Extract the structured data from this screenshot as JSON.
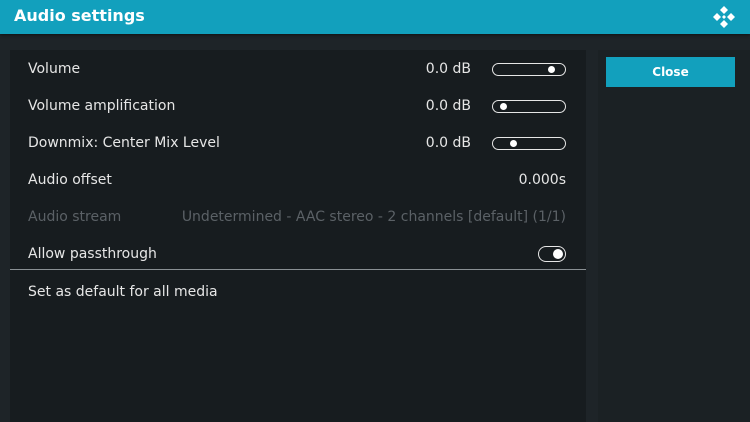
{
  "window": {
    "title": "Audio settings",
    "logo_icon": "kodi-logo-icon"
  },
  "settings": [
    {
      "label": "Volume",
      "value": "0.0 dB",
      "control": "slider",
      "position": 0.92
    },
    {
      "label": "Volume amplification",
      "value": "0.0 dB",
      "control": "slider",
      "position": 0.08
    },
    {
      "label": "Downmix: Center Mix Level",
      "value": "0.0 dB",
      "control": "slider",
      "position": 0.25
    },
    {
      "label": "Audio offset",
      "value": "0.000s",
      "control": "none"
    },
    {
      "label": "Audio stream",
      "value": "Undetermined - AAC stereo - 2 channels [default] (1/1)",
      "control": "none",
      "disabled": true
    },
    {
      "label": "Allow passthrough",
      "control": "toggle",
      "state": "on"
    }
  ],
  "actions": {
    "set_default_label": "Set as default for all media"
  },
  "sidebar": {
    "close_label": "Close"
  },
  "colors": {
    "accent": "#12a0bd",
    "background": "#1e2428",
    "panel": "#171c1f",
    "disabled_text": "#5b6166"
  }
}
